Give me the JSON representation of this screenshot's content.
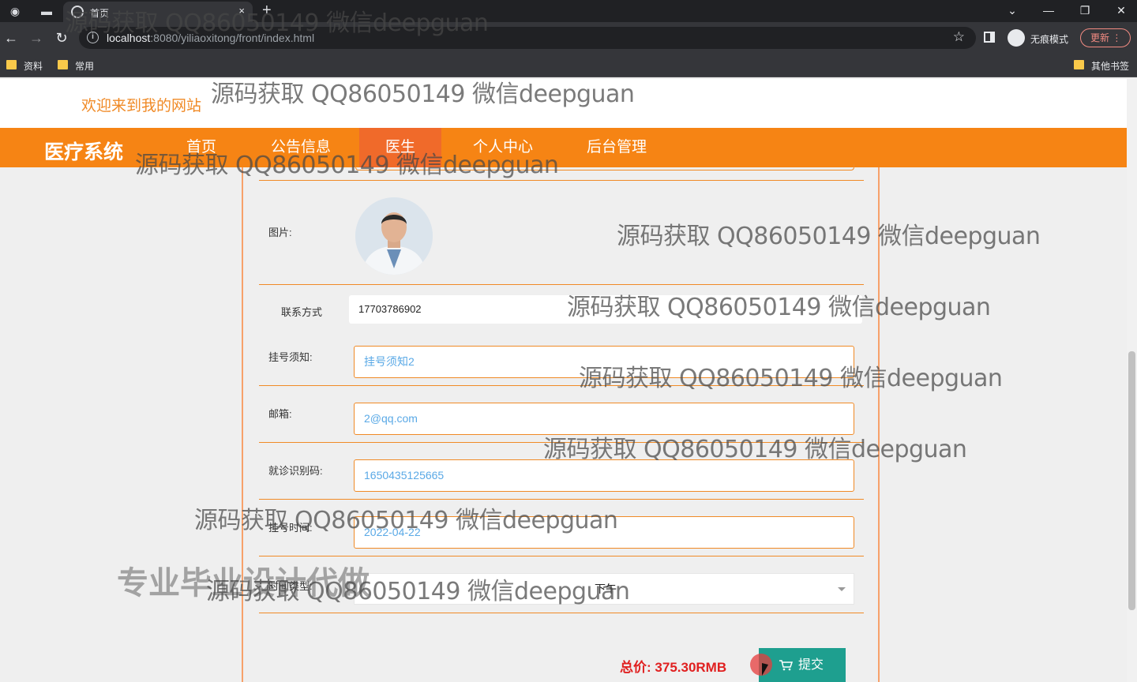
{
  "browser": {
    "tab_title": "首页",
    "tab_close": "×",
    "new_tab": "+",
    "url_host": "localhost",
    "url_rest": ":8080/yiliaoxitong/front/index.html",
    "incognito_label": "无痕模式",
    "update_label": "更新",
    "bookmarks": [
      "资料",
      "常用"
    ],
    "other_bookmarks": "其他书签"
  },
  "site": {
    "welcome": "欢迎来到我的网站",
    "brand": "医疗系统",
    "nav": [
      "首页",
      "公告信息",
      "医生",
      "个人中心",
      "后台管理"
    ],
    "active_nav": "医生"
  },
  "form": {
    "image_label": "图片:",
    "contact_label": "联系方式",
    "contact_value": "17703786902",
    "notice_label": "挂号须知:",
    "notice_value": "挂号须知2",
    "email_label": "邮箱:",
    "email_value": "2@qq.com",
    "code_label": "就诊识别码:",
    "code_value": "1650435125665",
    "time_label": "挂号时间:",
    "time_value": "2022-04-22",
    "period_label": "时间类型:",
    "period_value": "下午",
    "total_label": "总价:",
    "total_value": "375.30RMB",
    "submit_label": "提交"
  },
  "watermark": {
    "text": "源码获取 QQ86050149 微信deepguan",
    "big": "专业毕业设计代做"
  },
  "colors": {
    "accent": "#f68414",
    "active_nav": "#f06a2a",
    "submit": "#1e9f8f",
    "price": "#e02020"
  }
}
